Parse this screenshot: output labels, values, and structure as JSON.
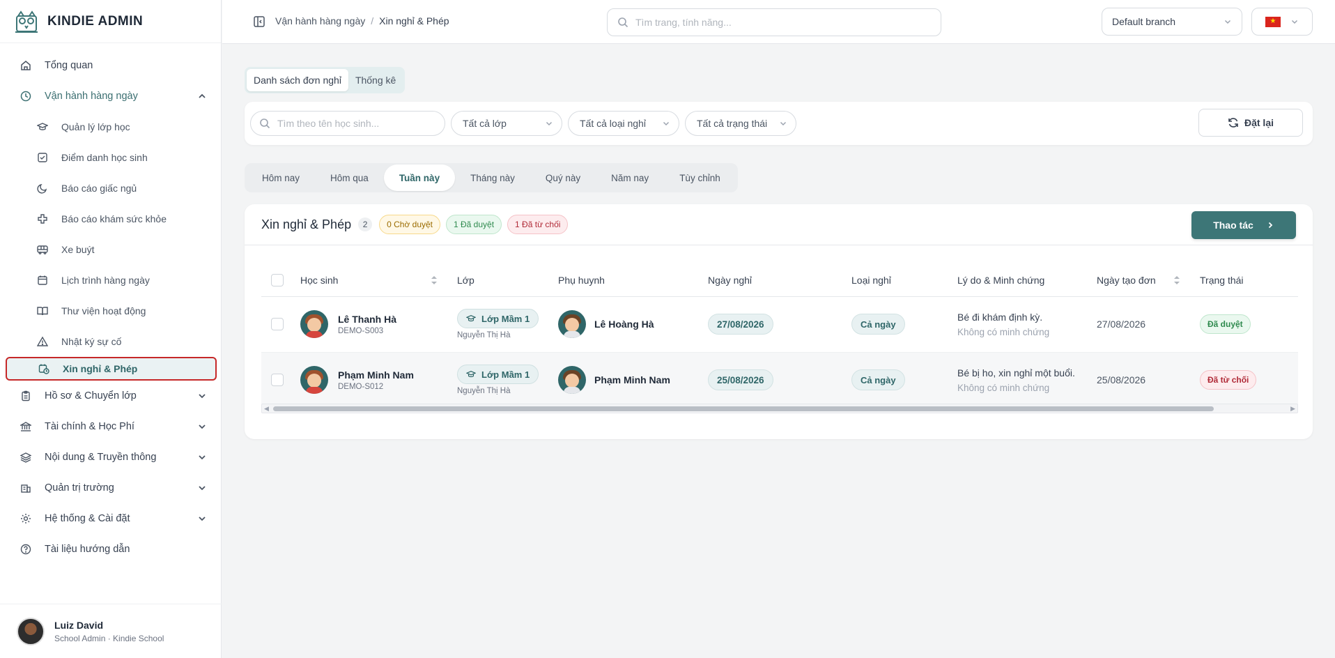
{
  "brand": {
    "name": "KINDIE ADMIN"
  },
  "sidebar": {
    "items": [
      {
        "label": "Tổng quan",
        "icon": "home-icon"
      },
      {
        "label": "Vận hành hàng ngày",
        "icon": "clock-icon",
        "expanded": true
      },
      {
        "label": "Hồ sơ & Chuyển lớp",
        "icon": "clipboard-icon"
      },
      {
        "label": "Tài chính & Học Phí",
        "icon": "bank-icon"
      },
      {
        "label": "Nội dung & Truyền thông",
        "icon": "layers-icon"
      },
      {
        "label": "Quản trị trường",
        "icon": "building-icon"
      },
      {
        "label": "Hệ thống & Cài đặt",
        "icon": "gear-icon"
      },
      {
        "label": "Tài liệu hướng dẫn",
        "icon": "help-circle-icon"
      }
    ],
    "sub_items": [
      {
        "label": "Quản lý lớp học",
        "icon": "graduation-cap-icon"
      },
      {
        "label": "Điểm danh học sinh",
        "icon": "check-square-icon"
      },
      {
        "label": "Báo cáo giấc ngủ",
        "icon": "moon-icon"
      },
      {
        "label": "Báo cáo khám sức khỏe",
        "icon": "medical-cross-icon"
      },
      {
        "label": "Xe buýt",
        "icon": "bus-icon"
      },
      {
        "label": "Lịch trình hàng ngày",
        "icon": "calendar-icon"
      },
      {
        "label": "Thư viện hoạt động",
        "icon": "book-icon"
      },
      {
        "label": "Nhật ký sự cố",
        "icon": "warning-icon"
      },
      {
        "label": "Xin nghỉ & Phép",
        "icon": "calendar-clock-icon",
        "active": true
      }
    ]
  },
  "profile": {
    "name": "Luiz David",
    "role": "School Admin · Kindie School"
  },
  "topbar": {
    "breadcrumb": [
      "Vận hành hàng ngày",
      "Xin nghỉ & Phép"
    ],
    "search_placeholder": "Tìm trang, tính năng...",
    "branch": "Default branch",
    "language_flag": "vn-flag-icon"
  },
  "view_tabs": [
    {
      "label": "Danh sách đơn nghỉ",
      "active": true
    },
    {
      "label": "Thống kê",
      "active": false
    }
  ],
  "filters": {
    "search_placeholder": "Tìm theo tên học sinh...",
    "class": "Tất cả lớp",
    "leave_type": "Tất cả loại nghỉ",
    "status": "Tất cả trạng thái",
    "reset_label": "Đặt lại"
  },
  "period_tabs": [
    {
      "label": "Hôm nay",
      "active": false
    },
    {
      "label": "Hôm qua",
      "active": false
    },
    {
      "label": "Tuần này",
      "active": true
    },
    {
      "label": "Tháng này",
      "active": false
    },
    {
      "label": "Quý này",
      "active": false
    },
    {
      "label": "Năm nay",
      "active": false
    },
    {
      "label": "Tùy chỉnh",
      "active": false
    }
  ],
  "list": {
    "title": "Xin nghỉ & Phép",
    "count": "2",
    "pending": "0 Chờ duyệt",
    "approved": "1 Đã duyệt",
    "rejected": "1 Đã từ chối",
    "action_label": "Thao tác",
    "columns": [
      "Học sinh",
      "Lớp",
      "Phụ huynh",
      "Ngày nghỉ",
      "Loại nghỉ",
      "Lý do & Minh chứng",
      "Ngày tạo đơn",
      "Trạng thái"
    ],
    "rows": [
      {
        "student": "Lê Thanh Hà",
        "code": "DEMO-S003",
        "class": "Lớp Mầm 1",
        "teacher": "Nguyễn Thị Hà",
        "parent": "Lê Hoàng Hà",
        "date": "27/08/2026",
        "type": "Cả ngày",
        "reason": "Bé đi khám định kỳ.",
        "evidence": "Không có minh chứng",
        "created": "27/08/2026",
        "status": "Đã duyệt"
      },
      {
        "student": "Phạm Minh Nam",
        "code": "DEMO-S012",
        "class": "Lớp Mầm 1",
        "teacher": "Nguyễn Thị Hà",
        "parent": "Phạm Minh Nam",
        "date": "25/08/2026",
        "type": "Cả ngày",
        "reason": "Bé bị ho, xin nghỉ một buổi.",
        "evidence": "Không có minh chứng",
        "created": "25/08/2026",
        "status": "Đã từ chối"
      }
    ]
  }
}
